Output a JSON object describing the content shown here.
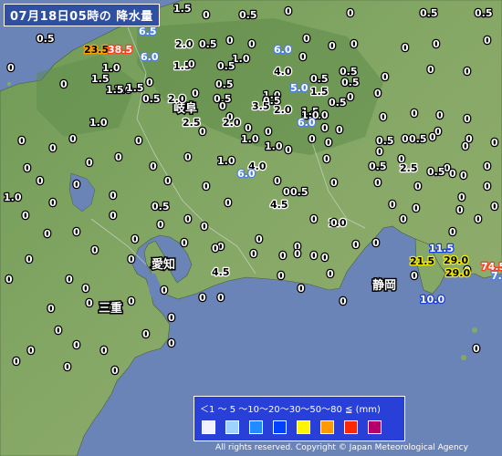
{
  "title": "07月18日05時の 降水量",
  "legend": {
    "scale_text": "＜1 ～ 5 ～10～20～30～50～80 ≦ (mm)",
    "colors": [
      "#f2f2ff",
      "#a0d2ff",
      "#218cff",
      "#0041ff",
      "#fff500",
      "#ff9900",
      "#ff2800",
      "#b40068"
    ]
  },
  "copyright": "All rights reserved. Copyright © Japan Meteorological Agency",
  "prefectures": [
    "岐阜",
    "愛知",
    "三重",
    "静岡"
  ],
  "stations": [
    {
      "v": "0.5",
      "lvl": "a"
    },
    {
      "v": "1.5",
      "lvl": "a"
    },
    {
      "v": "6.5",
      "lvl": "c"
    },
    {
      "v": "0",
      "lvl": "a"
    },
    {
      "v": "0.5",
      "lvl": "a"
    },
    {
      "v": "0",
      "lvl": "a"
    },
    {
      "v": "0",
      "lvl": "a"
    },
    {
      "v": "0",
      "lvl": "a"
    },
    {
      "v": "0.5",
      "lvl": "a"
    },
    {
      "v": "0.5",
      "lvl": "a"
    },
    {
      "v": "23.5",
      "lvl": "f"
    },
    {
      "v": "38.5",
      "lvl": "g"
    },
    {
      "v": "2.0",
      "lvl": "b"
    },
    {
      "v": "0.5",
      "lvl": "a"
    },
    {
      "v": "0",
      "lvl": "a"
    },
    {
      "v": "0",
      "lvl": "a"
    },
    {
      "v": "6.0",
      "lvl": "c"
    },
    {
      "v": "0",
      "lvl": "a"
    },
    {
      "v": "0",
      "lvl": "a"
    },
    {
      "v": "0",
      "lvl": "a"
    },
    {
      "v": "0",
      "lvl": "a"
    },
    {
      "v": "0",
      "lvl": "a"
    },
    {
      "v": "0",
      "lvl": "a"
    },
    {
      "v": "1.0",
      "lvl": "a"
    },
    {
      "v": "6.0",
      "lvl": "c"
    },
    {
      "v": "1.5",
      "lvl": "b"
    },
    {
      "v": "1.0",
      "lvl": "a"
    },
    {
      "v": "0",
      "lvl": "a"
    },
    {
      "v": "0.5",
      "lvl": "a"
    },
    {
      "v": "0",
      "lvl": "a"
    },
    {
      "v": "0.5",
      "lvl": "a"
    },
    {
      "v": "0",
      "lvl": "a"
    },
    {
      "v": "0",
      "lvl": "a"
    },
    {
      "v": "0",
      "lvl": "a"
    },
    {
      "v": "1.5",
      "lvl": "a"
    },
    {
      "v": "1.0",
      "lvl": "a"
    },
    {
      "v": "4.0",
      "lvl": "b"
    },
    {
      "v": "0.5",
      "lvl": "a"
    },
    {
      "v": "0",
      "lvl": "a"
    },
    {
      "v": "0",
      "lvl": "a"
    },
    {
      "v": "0.5",
      "lvl": "a"
    },
    {
      "v": "1.5",
      "lvl": "a"
    },
    {
      "v": "1.5",
      "lvl": "a"
    },
    {
      "v": "5.0",
      "lvl": "c"
    },
    {
      "v": "1.5",
      "lvl": "b"
    },
    {
      "v": "0.5",
      "lvl": "a"
    },
    {
      "v": "1.0",
      "lvl": "a"
    },
    {
      "v": "0.5",
      "lvl": "a"
    },
    {
      "v": "0",
      "lvl": "a"
    },
    {
      "v": "0.5",
      "lvl": "a"
    },
    {
      "v": "0",
      "lvl": "a"
    },
    {
      "v": "2.0",
      "lvl": "b"
    },
    {
      "v": "0.5",
      "lvl": "a"
    },
    {
      "v": "3.5",
      "lvl": "b"
    },
    {
      "v": "2.0",
      "lvl": "b"
    },
    {
      "v": "0.5",
      "lvl": "a"
    },
    {
      "v": "0",
      "lvl": "a"
    },
    {
      "v": "1.0",
      "lvl": "a"
    },
    {
      "v": "1.0",
      "lvl": "a"
    },
    {
      "v": "1.5",
      "lvl": "a"
    },
    {
      "v": "0",
      "lvl": "a"
    },
    {
      "v": "0",
      "lvl": "a"
    },
    {
      "v": "0",
      "lvl": "a"
    },
    {
      "v": "0",
      "lvl": "a"
    },
    {
      "v": "1.0",
      "lvl": "a"
    },
    {
      "v": "2.5",
      "lvl": "b"
    },
    {
      "v": "2.0",
      "lvl": "b"
    },
    {
      "v": "0",
      "lvl": "a"
    },
    {
      "v": "6.0",
      "lvl": "c"
    },
    {
      "v": "0",
      "lvl": "a"
    },
    {
      "v": "0",
      "lvl": "a"
    },
    {
      "v": "0.5",
      "lvl": "a"
    },
    {
      "v": "0",
      "lvl": "a"
    },
    {
      "v": "0",
      "lvl": "a"
    },
    {
      "v": "0",
      "lvl": "a"
    },
    {
      "v": "0",
      "lvl": "a"
    },
    {
      "v": "0",
      "lvl": "a"
    },
    {
      "v": "0",
      "lvl": "a"
    },
    {
      "v": "1.0",
      "lvl": "a"
    },
    {
      "v": "1.0",
      "lvl": "a"
    },
    {
      "v": "0",
      "lvl": "a"
    },
    {
      "v": "0",
      "lvl": "a"
    },
    {
      "v": "0",
      "lvl": "a"
    },
    {
      "v": "0",
      "lvl": "a"
    },
    {
      "v": "0.5",
      "lvl": "a"
    },
    {
      "v": "0",
      "lvl": "a"
    },
    {
      "v": "0",
      "lvl": "a"
    },
    {
      "v": "0",
      "lvl": "a"
    },
    {
      "v": "0",
      "lvl": "a"
    },
    {
      "v": "0",
      "lvl": "a"
    },
    {
      "v": "1.0",
      "lvl": "a"
    },
    {
      "v": "4.0",
      "lvl": "b"
    },
    {
      "v": "0",
      "lvl": "a"
    },
    {
      "v": "0",
      "lvl": "a"
    },
    {
      "v": "0.5",
      "lvl": "a"
    },
    {
      "v": "0",
      "lvl": "a"
    },
    {
      "v": "0",
      "lvl": "a"
    },
    {
      "v": "0",
      "lvl": "a"
    },
    {
      "v": "6.0",
      "lvl": "c"
    },
    {
      "v": "0",
      "lvl": "a"
    },
    {
      "v": "0",
      "lvl": "a"
    },
    {
      "v": "0",
      "lvl": "a"
    },
    {
      "v": "0",
      "lvl": "a"
    },
    {
      "v": "0",
      "lvl": "a"
    },
    {
      "v": "0",
      "lvl": "a"
    },
    {
      "v": "2.5",
      "lvl": "b"
    },
    {
      "v": "0",
      "lvl": "a"
    },
    {
      "v": "0",
      "lvl": "a"
    },
    {
      "v": "0.5",
      "lvl": "a"
    },
    {
      "v": "0",
      "lvl": "a"
    },
    {
      "v": "0",
      "lvl": "a"
    },
    {
      "v": "0",
      "lvl": "a"
    },
    {
      "v": "0",
      "lvl": "a"
    },
    {
      "v": "1.0",
      "lvl": "a"
    },
    {
      "v": "0",
      "lvl": "a"
    },
    {
      "v": "0",
      "lvl": "a"
    },
    {
      "v": "0.5",
      "lvl": "a"
    },
    {
      "v": "0",
      "lvl": "a"
    },
    {
      "v": "0",
      "lvl": "a"
    },
    {
      "v": "0",
      "lvl": "a"
    },
    {
      "v": "0",
      "lvl": "a"
    },
    {
      "v": "0",
      "lvl": "a"
    },
    {
      "v": "4.5",
      "lvl": "b"
    },
    {
      "v": "0",
      "lvl": "a"
    },
    {
      "v": "0",
      "lvl": "a"
    },
    {
      "v": "0",
      "lvl": "a"
    },
    {
      "v": "0",
      "lvl": "a"
    },
    {
      "v": "0.5",
      "lvl": "a"
    },
    {
      "v": "0",
      "lvl": "a"
    },
    {
      "v": "0",
      "lvl": "a"
    },
    {
      "v": "0",
      "lvl": "a"
    },
    {
      "v": "0",
      "lvl": "a"
    },
    {
      "v": "0",
      "lvl": "a"
    },
    {
      "v": "0",
      "lvl": "a"
    },
    {
      "v": "0",
      "lvl": "a"
    },
    {
      "v": "2.0",
      "lvl": "b"
    },
    {
      "v": "0",
      "lvl": "a"
    },
    {
      "v": "0",
      "lvl": "a"
    },
    {
      "v": "0",
      "lvl": "a"
    },
    {
      "v": "0",
      "lvl": "a"
    },
    {
      "v": "0",
      "lvl": "a"
    },
    {
      "v": "0",
      "lvl": "a"
    },
    {
      "v": "0",
      "lvl": "a"
    },
    {
      "v": "0",
      "lvl": "a"
    },
    {
      "v": "0",
      "lvl": "a"
    },
    {
      "v": "0",
      "lvl": "a"
    },
    {
      "v": "0",
      "lvl": "a"
    },
    {
      "v": "0",
      "lvl": "a"
    },
    {
      "v": "0",
      "lvl": "a"
    },
    {
      "v": "0",
      "lvl": "a"
    },
    {
      "v": "0",
      "lvl": "a"
    },
    {
      "v": "11.5",
      "lvl": "d"
    },
    {
      "v": "0",
      "lvl": "a"
    },
    {
      "v": "0",
      "lvl": "a"
    },
    {
      "v": "0",
      "lvl": "a"
    },
    {
      "v": "0",
      "lvl": "a"
    },
    {
      "v": "21.5",
      "lvl": "e"
    },
    {
      "v": "29.0",
      "lvl": "e"
    },
    {
      "v": "0",
      "lvl": "a"
    },
    {
      "v": "0",
      "lvl": "a"
    },
    {
      "v": "0",
      "lvl": "a"
    },
    {
      "v": "0",
      "lvl": "a"
    },
    {
      "v": "0",
      "lvl": "a"
    },
    {
      "v": "0",
      "lvl": "a"
    },
    {
      "v": "0",
      "lvl": "a"
    },
    {
      "v": "0",
      "lvl": "a"
    },
    {
      "v": "0",
      "lvl": "a"
    },
    {
      "v": "29.0",
      "lvl": "e"
    },
    {
      "v": "74.5",
      "lvl": "g"
    },
    {
      "v": "7.0",
      "lvl": "c"
    },
    {
      "v": "4.5",
      "lvl": "b"
    },
    {
      "v": "0",
      "lvl": "a"
    },
    {
      "v": "0",
      "lvl": "a"
    },
    {
      "v": "0",
      "lvl": "a"
    },
    {
      "v": "10.0",
      "lvl": "d"
    },
    {
      "v": "0",
      "lvl": "a"
    },
    {
      "v": "0",
      "lvl": "a"
    },
    {
      "v": "0",
      "lvl": "a"
    },
    {
      "v": "0",
      "lvl": "a"
    },
    {
      "v": "0",
      "lvl": "a"
    },
    {
      "v": "0",
      "lvl": "a"
    },
    {
      "v": "0",
      "lvl": "a"
    },
    {
      "v": "0",
      "lvl": "a"
    },
    {
      "v": "0",
      "lvl": "a"
    },
    {
      "v": "0",
      "lvl": "a"
    },
    {
      "v": "0",
      "lvl": "a"
    },
    {
      "v": "0",
      "lvl": "a"
    },
    {
      "v": "0",
      "lvl": "a"
    },
    {
      "v": "0",
      "lvl": "a"
    },
    {
      "v": "0",
      "lvl": "a"
    },
    {
      "v": "0",
      "lvl": "a"
    },
    {
      "v": "0",
      "lvl": "a"
    },
    {
      "v": "0",
      "lvl": "a"
    },
    {
      "v": "0",
      "lvl": "a"
    },
    {
      "v": "0",
      "lvl": "a"
    }
  ]
}
